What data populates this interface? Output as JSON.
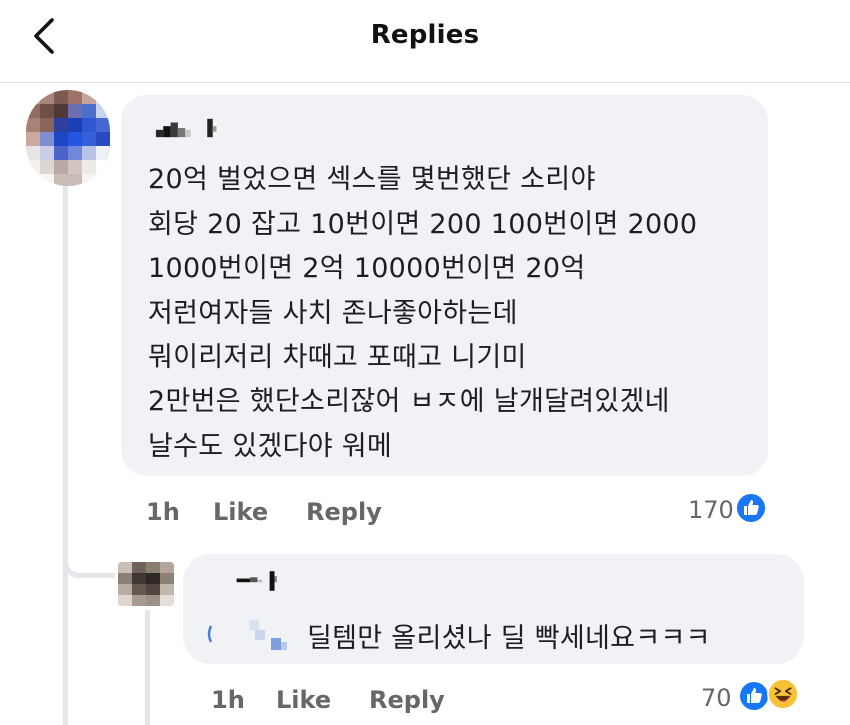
{
  "header": {
    "title": "Replies",
    "back_icon": "chevron-left-icon"
  },
  "comment": {
    "lines": [
      "20억 벌었으면 섹스를 몇번했단 소리야",
      "회당 20 잡고 10번이면 200 100번이면 2000",
      "1000번이면 2억 10000번이면 20억",
      "저런여자들 사치 존나좋아하는데",
      "뭐이리저리 차때고 포때고 니기미",
      "2만번은 했단소리잖어 ㅂㅈ에 날개달려있겠네",
      "날수도 있겠다야 워메"
    ],
    "time": "1h",
    "like_label": "Like",
    "reply_label": "Reply",
    "reaction_count": "170",
    "reaction_icons": [
      "like-icon"
    ],
    "colors": {
      "like_blue": "#1877f2"
    }
  },
  "reply": {
    "text": "딜템만 올리셨나 딜 빡세네요ㅋㅋㅋ",
    "time": "1h",
    "like_label": "Like",
    "reply_label": "Reply",
    "reaction_count": "70",
    "reaction_icons": [
      "like-icon",
      "haha-icon"
    ]
  }
}
